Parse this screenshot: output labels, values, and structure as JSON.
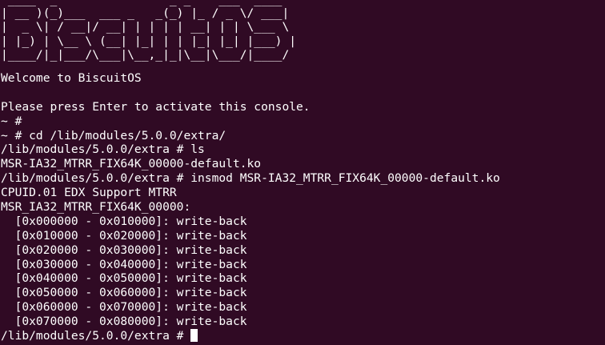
{
  "terminal": {
    "banner": [
      " ____  _                _ _    ___  ____  ",
      "| __ )(_)___  ___ _   _(_) |_ / _ \\/ ___| ",
      "|  _ \\| / __|/ __| | | | | __| | | \\___ \\ ",
      "| |_) | \\__ \\ (__| |_| | | |_| |_| |___) |",
      "|____/|_|___/\\___|\\__,_|_|\\__|\\___/|____/ "
    ],
    "lines": [
      "Welcome to BiscuitOS",
      "",
      "Please press Enter to activate this console.",
      "~ #",
      "~ # cd /lib/modules/5.0.0/extra/",
      "/lib/modules/5.0.0/extra # ls",
      "MSR-IA32_MTRR_FIX64K_00000-default.ko",
      "/lib/modules/5.0.0/extra # insmod MSR-IA32_MTRR_FIX64K_00000-default.ko",
      "CPUID.01 EDX Support MTRR",
      "MSR_IA32_MTRR_FIX64K_00000:",
      "  [0x000000 - 0x010000]: write-back",
      "  [0x010000 - 0x020000]: write-back",
      "  [0x020000 - 0x030000]: write-back",
      "  [0x030000 - 0x040000]: write-back",
      "  [0x040000 - 0x050000]: write-back",
      "  [0x050000 - 0x060000]: write-back",
      "  [0x060000 - 0x070000]: write-back",
      "  [0x070000 - 0x080000]: write-back"
    ],
    "prompt": "/lib/modules/5.0.0/extra # "
  }
}
